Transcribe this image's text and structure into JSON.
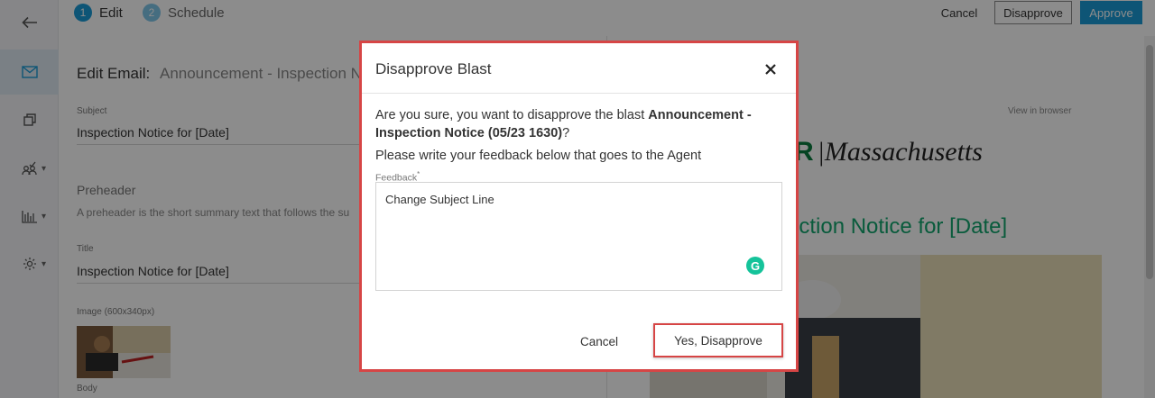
{
  "steps": [
    {
      "number": "1",
      "label": "Edit"
    },
    {
      "number": "2",
      "label": "Schedule"
    }
  ],
  "top_actions": {
    "cancel_label": "Cancel",
    "disapprove_label": "Disapprove",
    "approve_label": "Approve"
  },
  "sidebar": {
    "items": [
      {
        "icon": "back-arrow-icon"
      },
      {
        "icon": "mail-icon",
        "active": true
      },
      {
        "icon": "copy-icon"
      },
      {
        "icon": "contacts-icon"
      },
      {
        "icon": "bar-chart-icon"
      },
      {
        "icon": "gear-icon"
      }
    ]
  },
  "editor": {
    "heading_prefix": "Edit Email:",
    "heading_name": "Announcement - Inspection N",
    "subject_label": "Subject",
    "subject_value": "Inspection Notice for [Date]",
    "preheader_title": "Preheader",
    "preheader_help": "A preheader is the short summary text that follows the su",
    "title_label": "Title",
    "title_value": "Inspection Notice for [Date]",
    "image_label": "Image (600x340px)",
    "body_label": "Body"
  },
  "preview": {
    "view_in_browser": "View in browser",
    "brand_mark": "R",
    "brand_name": "|Massachusetts",
    "title_fragment": "ection Notice for [Date]"
  },
  "modal": {
    "title": "Disapprove Blast",
    "question_prefix": "Are you sure, you want to disapprove the blast ",
    "blast_name": "Announcement - Inspection Notice (05/23 1630)",
    "question_suffix": "?",
    "instruction": "Please write your feedback below that goes to the Agent",
    "feedback_label": "Feedback",
    "feedback_required_mark": "*",
    "feedback_value": "Change Subject Line",
    "grammarly_letter": "G",
    "cancel_label": "Cancel",
    "confirm_label": "Yes, Disapprove"
  },
  "colors": {
    "accent": "#1a9bd7",
    "highlight_border": "#d64545",
    "preview_title": "#12a66e",
    "grammarly": "#15c39a"
  }
}
